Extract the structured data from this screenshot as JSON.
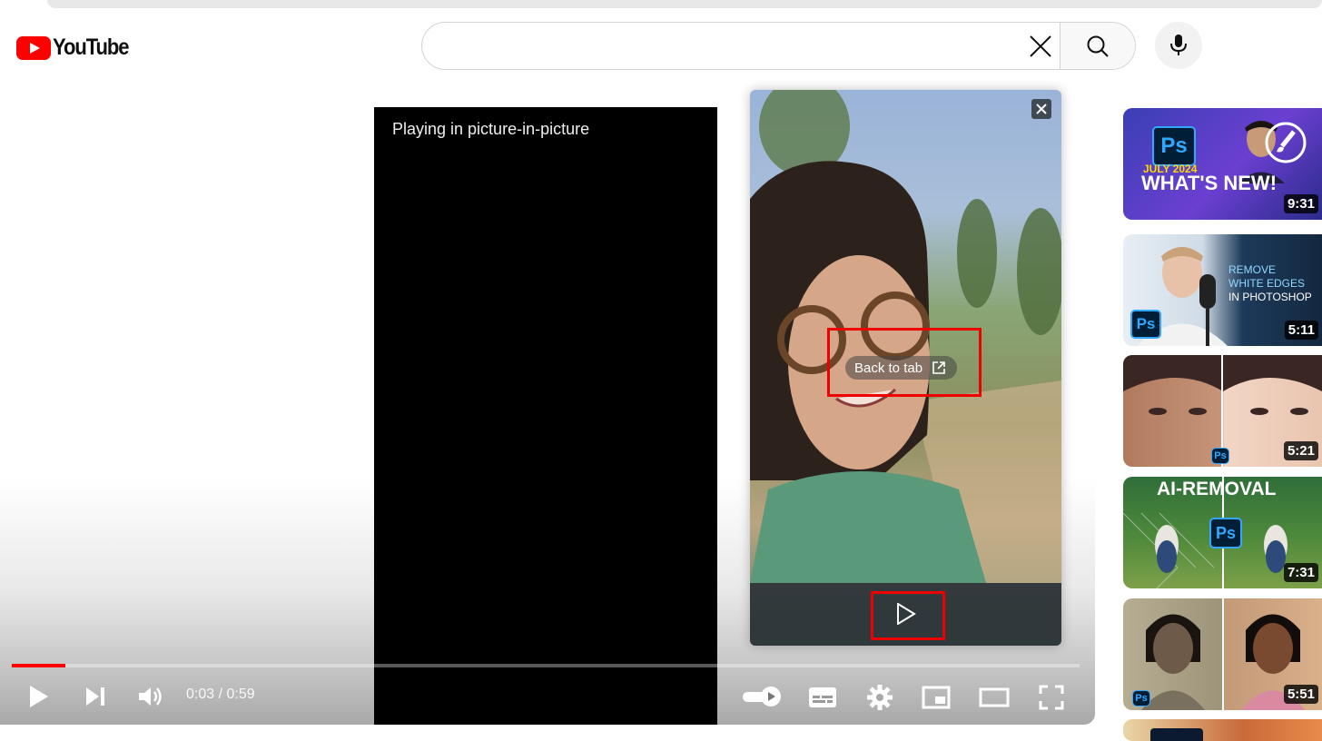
{
  "header": {
    "logo_text": "YouTube",
    "search_value": "",
    "icons": {
      "clear": "close-icon",
      "search": "search-icon",
      "mic": "microphone-icon"
    }
  },
  "player": {
    "pip_message": "Playing in picture-in-picture",
    "time_current": "0:03",
    "time_separator": " / ",
    "time_total": "0:59",
    "progress_fraction": 0.05,
    "icons": [
      "play-icon",
      "next-icon",
      "volume-icon",
      "autoplay-toggle-icon",
      "subtitles-icon",
      "settings-icon",
      "miniplayer-icon",
      "theater-mode-icon",
      "fullscreen-icon"
    ]
  },
  "pip": {
    "back_to_tab_label": "Back to tab",
    "icons": {
      "close": "close-icon",
      "back": "open-external-icon",
      "play": "play-icon"
    },
    "highlight_color": "#ee0000"
  },
  "sidebar": {
    "videos": [
      {
        "duration": "9:31",
        "overlay_lines": [
          "JULY 2024",
          "WHAT'S NEW!"
        ],
        "badge": "Ps"
      },
      {
        "duration": "5:11",
        "overlay_lines": [
          "REMOVE",
          "WHITE EDGES",
          "IN PHOTOSHOP"
        ],
        "badge": "Ps"
      },
      {
        "duration": "5:21",
        "overlay_lines": [],
        "badge": "Ps"
      },
      {
        "duration": "7:31",
        "overlay_lines": [
          "AI-REMOVAL"
        ],
        "badge": "Ps"
      },
      {
        "duration": "5:51",
        "overlay_lines": [],
        "badge": "Ps"
      }
    ]
  },
  "colors": {
    "brand_red": "#ff0000",
    "progress_red": "#ff0000",
    "ps_blue": "#31a8ff"
  }
}
